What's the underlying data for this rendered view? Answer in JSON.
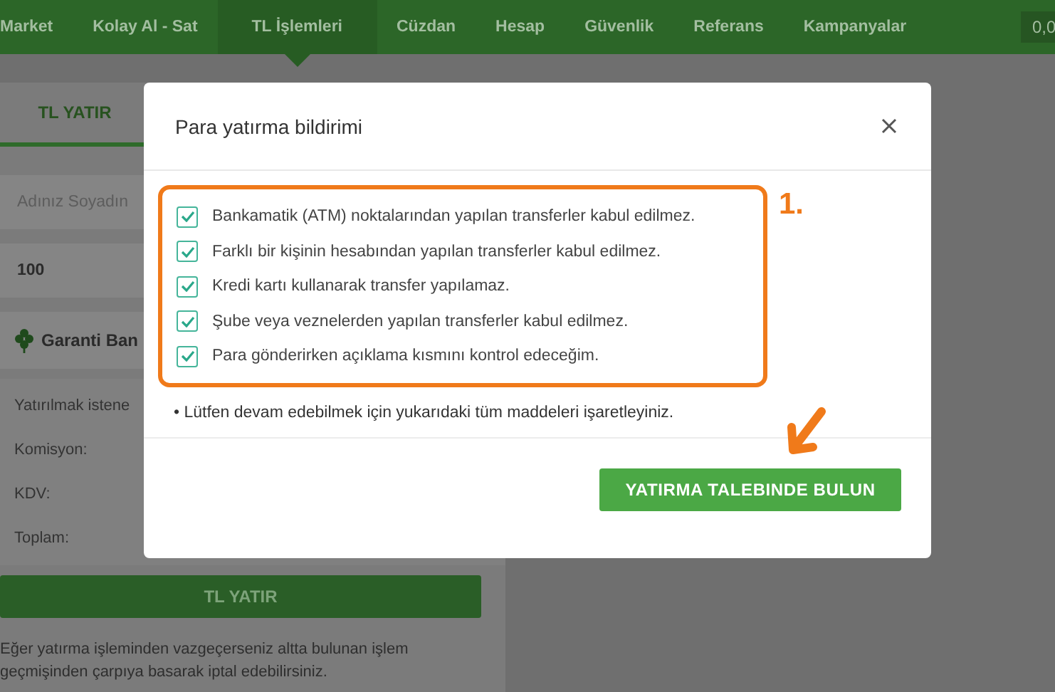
{
  "nav": {
    "items": [
      {
        "label": "Market",
        "selected": false
      },
      {
        "label": "Kolay Al - Sat",
        "selected": false
      },
      {
        "label": "TL İşlemleri",
        "selected": true
      },
      {
        "label": "Cüzdan",
        "selected": false
      },
      {
        "label": "Hesap",
        "selected": false
      },
      {
        "label": "Güvenlik",
        "selected": false
      },
      {
        "label": "Referans",
        "selected": false
      },
      {
        "label": "Kampanyalar",
        "selected": false
      }
    ],
    "balance": "0,0"
  },
  "panel": {
    "tabs": [
      {
        "label": "TL YATIR",
        "selected": true
      }
    ],
    "name_field": {
      "placeholder": "Adınız Soyadın"
    },
    "amount_field": {
      "value": "100"
    },
    "bank": "Garanti Ban",
    "summary": [
      "Yatırılmak istene",
      "Komisyon:",
      "KDV:",
      "Toplam:"
    ],
    "submit": "TL YATIR",
    "note": "Eğer yatırma işleminden vazgeçerseniz altta bulunan işlem geçmişinden çarpıya basarak iptal edebilirsiniz."
  },
  "dialog": {
    "title": "Para yatırma bildirimi",
    "checklist": [
      {
        "label": "Bankamatik (ATM) noktalarından yapılan transferler kabul edilmez.",
        "checked": true
      },
      {
        "label": "Farklı bir kişinin hesabından yapılan transferler kabul edilmez.",
        "checked": true
      },
      {
        "label": "Kredi kartı kullanarak transfer yapılamaz.",
        "checked": true
      },
      {
        "label": "Şube veya veznelerden yapılan transferler kabul edilmez.",
        "checked": true
      },
      {
        "label": "Para gönderirken açıklama kısmını kontrol edeceğim.",
        "checked": true
      }
    ],
    "annotation": "1.",
    "note": "• Lütfen devam edebilmek için yukarıdaki tüm maddeleri işaretleyiniz.",
    "button": "YATIRMA TALEBINDE BULUN"
  }
}
